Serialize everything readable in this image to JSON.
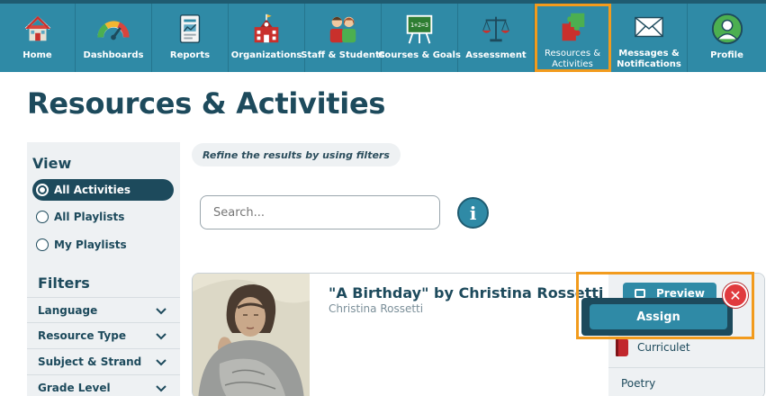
{
  "nav": {
    "items": [
      {
        "label": "Home",
        "icon": "home-icon"
      },
      {
        "label": "Dashboards",
        "icon": "gauge-icon"
      },
      {
        "label": "Reports",
        "icon": "report-icon"
      },
      {
        "label": "Organizations",
        "icon": "school-building-icon"
      },
      {
        "label": "Staff & Students",
        "icon": "people-icon"
      },
      {
        "label": "Courses & Goals",
        "icon": "chalkboard-icon"
      },
      {
        "label": "Assessment",
        "icon": "scales-icon"
      },
      {
        "label": "Resources &",
        "label2": "Activities",
        "icon": "puzzle-icon"
      },
      {
        "label": "Messages &",
        "label2": "Notifications",
        "icon": "envelope-icon"
      },
      {
        "label": "Profile",
        "icon": "user-avatar-icon"
      }
    ],
    "active_index": 7,
    "highlight_color": "#f29b1d"
  },
  "page": {
    "title": "Resources & Activities"
  },
  "sidebar": {
    "view_heading": "View",
    "view_options": [
      {
        "label": "All Activities",
        "selected": true
      },
      {
        "label": "All Playlists",
        "selected": false
      },
      {
        "label": "My Playlists",
        "selected": false
      }
    ],
    "filters_heading": "Filters",
    "filters": [
      {
        "label": "Language"
      },
      {
        "label": "Resource Type"
      },
      {
        "label": "Subject & Strand"
      },
      {
        "label": "Grade Level"
      }
    ]
  },
  "refine_hint": "Refine the results by using filters",
  "search": {
    "placeholder": "Search...",
    "value": ""
  },
  "info_button": {
    "glyph": "i"
  },
  "card": {
    "title": "\"A Birthday\" by Christina Rossetti",
    "author": "Christina Rossetti",
    "preview_label": "Preview",
    "resource_type": "Curriculet",
    "genre": "Poetry"
  },
  "assign_popup": {
    "assign_label": "Assign",
    "close_glyph": "✕"
  },
  "colors": {
    "nav_bg": "#2f8aa6",
    "dark_teal": "#1d4a5c",
    "accent_orange": "#f29b1d",
    "close_red": "#e03a3e"
  }
}
